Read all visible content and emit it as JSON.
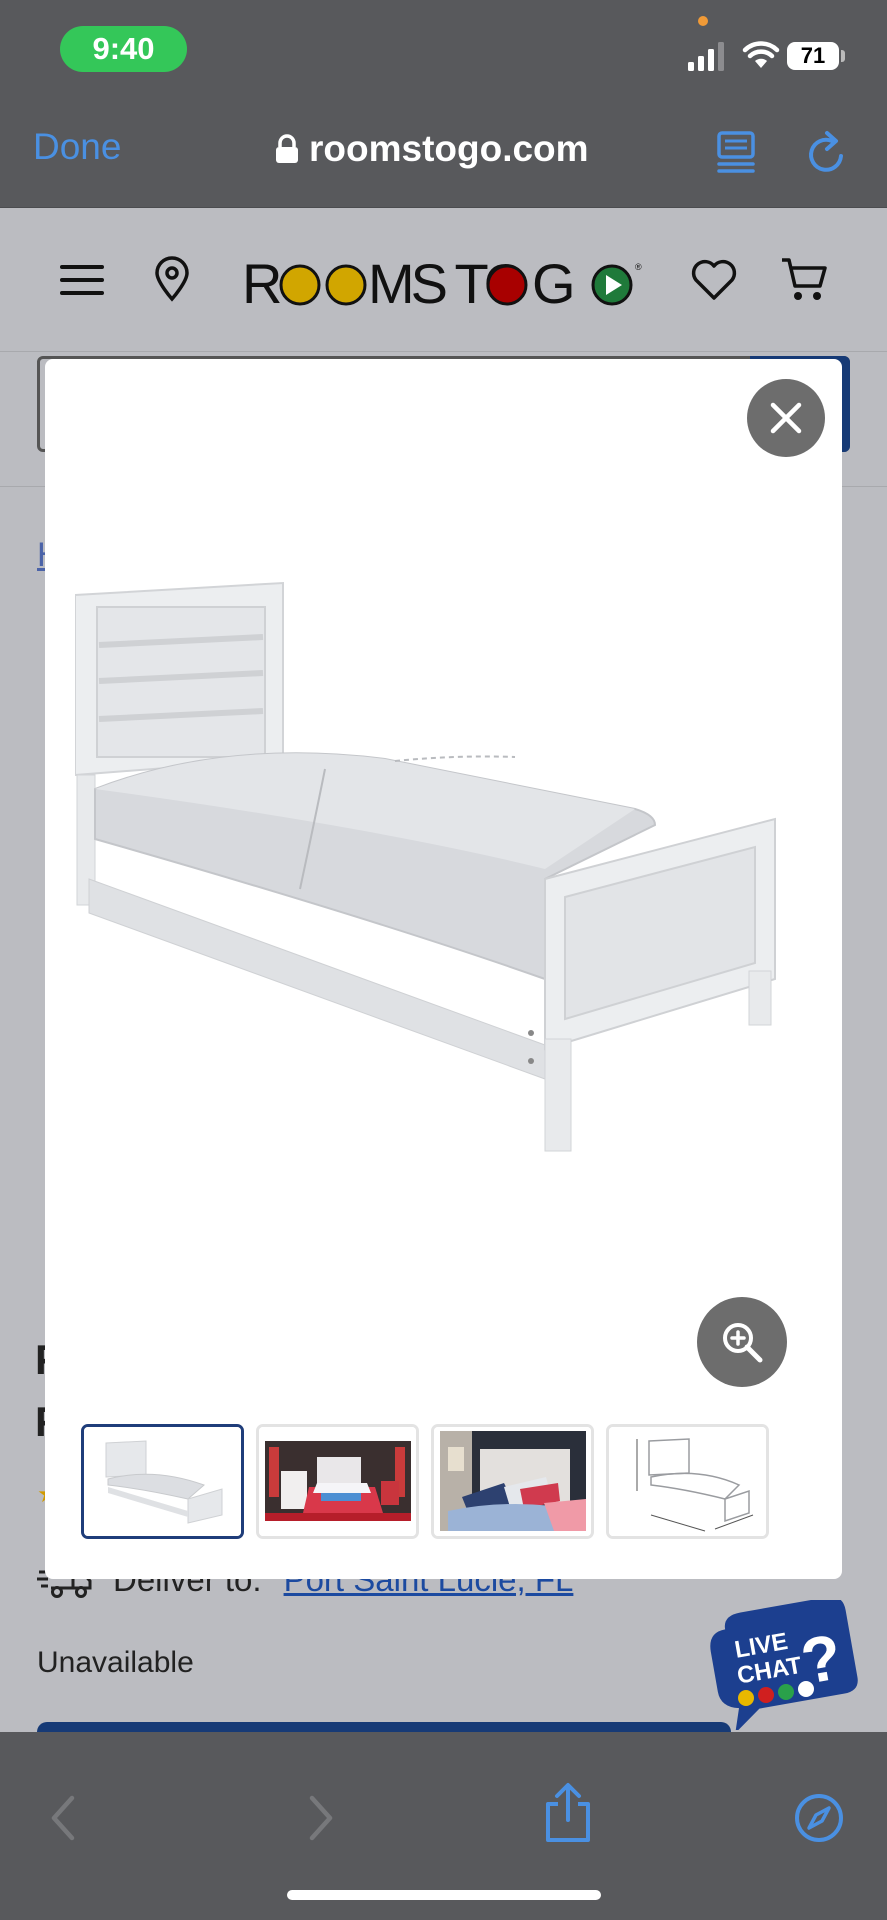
{
  "status_bar": {
    "time": "9:40",
    "battery": "71"
  },
  "browser": {
    "done_label": "Done",
    "url": "roomstogo.com"
  },
  "site": {
    "logo_text": "ROOMS TO GO",
    "breadcrumb_char": "H",
    "title_line1": "F",
    "title_line2": "F",
    "deliver_label": "Deliver to:",
    "deliver_location": "Port Saint Lucie, FL",
    "availability": "Unavailable",
    "live_chat": {
      "line1": "LIVE",
      "line2": "CHAT"
    }
  },
  "modal": {
    "thumbnails": [
      {
        "name": "bed-white",
        "selected": true
      },
      {
        "name": "room-red",
        "selected": false
      },
      {
        "name": "room-pillows",
        "selected": false
      },
      {
        "name": "bed-dimensions",
        "selected": false
      }
    ]
  },
  "colors": {
    "accent_blue": "#4a90e2",
    "brand_navy": "#163a76",
    "time_pill_green": "#34c759"
  }
}
